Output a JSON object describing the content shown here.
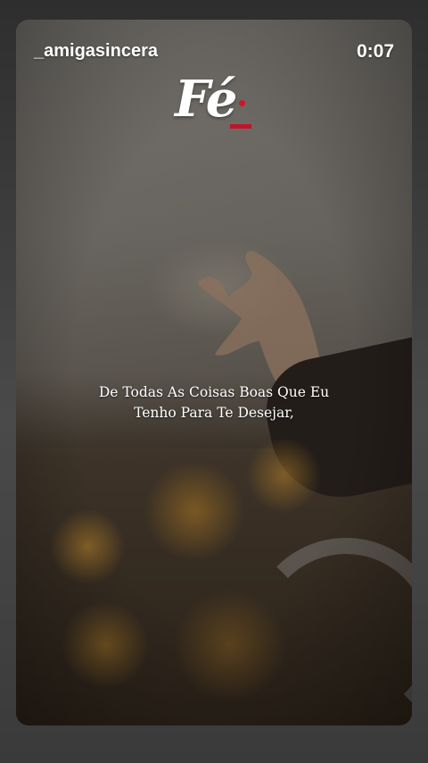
{
  "story": {
    "username": "_amigasincera",
    "timer": "0:07",
    "logo_text": "Fé",
    "caption_lines": [
      "De Todas As Coisas Boas Que Eu",
      "Tenho Para Te Desejar,"
    ]
  },
  "colors": {
    "logo_accent": "#d0152b",
    "text": "#ffffff"
  }
}
